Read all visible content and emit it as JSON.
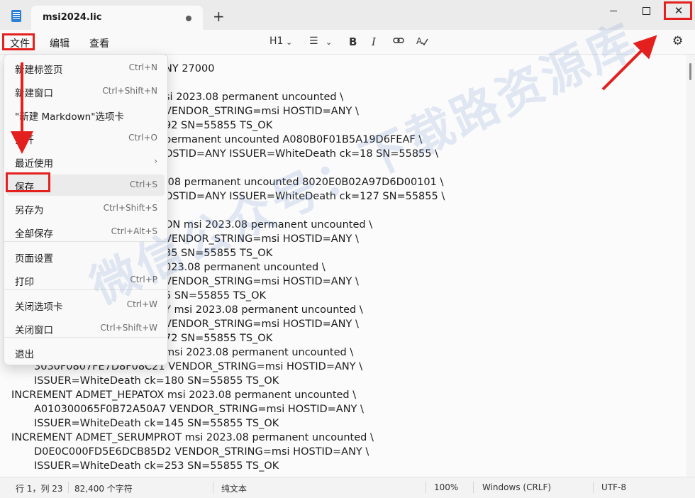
{
  "tab": {
    "title": "msi2024.lic"
  },
  "window": {
    "minimize": "—",
    "maximize": "☐",
    "close": "✕"
  },
  "menubar": {
    "file": "文件",
    "edit": "编辑",
    "view": "查看"
  },
  "toolbar": {
    "heading": "H1",
    "chevron": "⌄",
    "list": "☰",
    "bold": "B",
    "italic": "I",
    "link": "⊂⊃",
    "spell": "A͟"
  },
  "file_menu": [
    {
      "label": "新建标签页",
      "shortcut": "Ctrl+N"
    },
    {
      "label": "新建窗口",
      "shortcut": "Ctrl+Shift+N"
    },
    {
      "label": "\"新建 Markdown\"选项卡",
      "shortcut": ""
    },
    {
      "label": "打开",
      "shortcut": "Ctrl+O"
    },
    {
      "label": "最近使用",
      "shortcut": "›"
    },
    {
      "label": "保存",
      "shortcut": "Ctrl+S"
    },
    {
      "label": "另存为",
      "shortcut": "Ctrl+Shift+S"
    },
    {
      "label": "全部保存",
      "shortcut": "Ctrl+Alt+S"
    },
    {
      "label": "页面设置",
      "shortcut": ""
    },
    {
      "label": "打印",
      "shortcut": "Ctrl+P"
    },
    {
      "label": "关闭选项卡",
      "shortcut": "Ctrl+W"
    },
    {
      "label": "关闭窗口",
      "shortcut": "Ctrl+Shift+W"
    },
    {
      "label": "退出",
      "shortcut": ""
    }
  ],
  "editor_lines": [
    "NY 27000",
    "",
    "si 2023.08 permanent uncounted \\",
    "VENDOR_STRING=msi HOSTID=ANY \\",
    "92 SN=55855 TS_OK",
    "permanent uncounted A080B0F01B5A19D6FEAF \\",
    "OSTID=ANY ISSUER=WhiteDeath ck=18 SN=55855 \\",
    "",
    ".08 permanent uncounted 8020E0B02A97D6D00101 \\",
    "OSTID=ANY ISSUER=WhiteDeath ck=127 SN=55855 \\",
    "",
    "ON msi 2023.08 permanent uncounted \\",
    "VENDOR_STRING=msi HOSTID=ANY \\",
    "35 SN=55855 TS_OK",
    "023.08 permanent uncounted \\",
    "VENDOR_STRING=msi HOSTID=ANY \\",
    "5 SN=55855 TS_OK",
    "Y msi 2023.08 permanent uncounted \\",
    "VENDOR_STRING=msi HOSTID=ANY \\",
    "72 SN=55855 TS_OK",
    "msi 2023.08 permanent uncounted \\",
    "3030F0807FE7D8F08C21 VENDOR_STRING=msi HOSTID=ANY \\",
    "ISSUER=WhiteDeath ck=180 SN=55855 TS_OK",
    "INCREMENT ADMET_HEPATOX msi 2023.08 permanent uncounted \\",
    "A010300065F0B72A50A7 VENDOR_STRING=msi HOSTID=ANY \\",
    "ISSUER=WhiteDeath ck=145 SN=55855 TS_OK",
    "INCREMENT ADMET_SERUMPROT msi 2023.08 permanent uncounted \\",
    "D0E0C000FD5E6DCB85D2 VENDOR_STRING=msi HOSTID=ANY \\",
    "ISSUER=WhiteDeath ck=253 SN=55855 TS_OK"
  ],
  "status": {
    "position": "行 1，列 23",
    "chars": "82,400 个字符",
    "format": "纯文本",
    "zoom": "100%",
    "eol": "Windows (CRLF)",
    "encoding": "UTF-8"
  },
  "watermark": "微信公众号：下载路资源库"
}
